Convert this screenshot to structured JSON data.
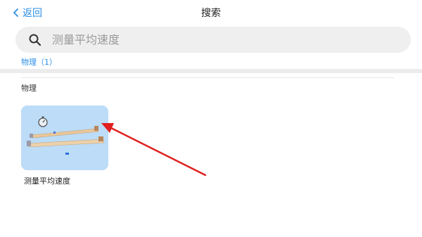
{
  "header": {
    "back_label": "返回",
    "title": "搜索"
  },
  "search": {
    "placeholder": "测量平均速度",
    "value": ""
  },
  "filter": {
    "tab_label": "物理（1）"
  },
  "section": {
    "title": "物理"
  },
  "results": [
    {
      "label": "测量平均速度"
    }
  ],
  "colors": {
    "accent": "#2b8fe6",
    "search_bg": "#efefef",
    "thumb_bg": "#bcdcf7",
    "annotation_arrow": "#e02020"
  },
  "icons": {
    "back": "chevron-left-icon",
    "search": "search-icon",
    "annotation": "red-arrow"
  }
}
